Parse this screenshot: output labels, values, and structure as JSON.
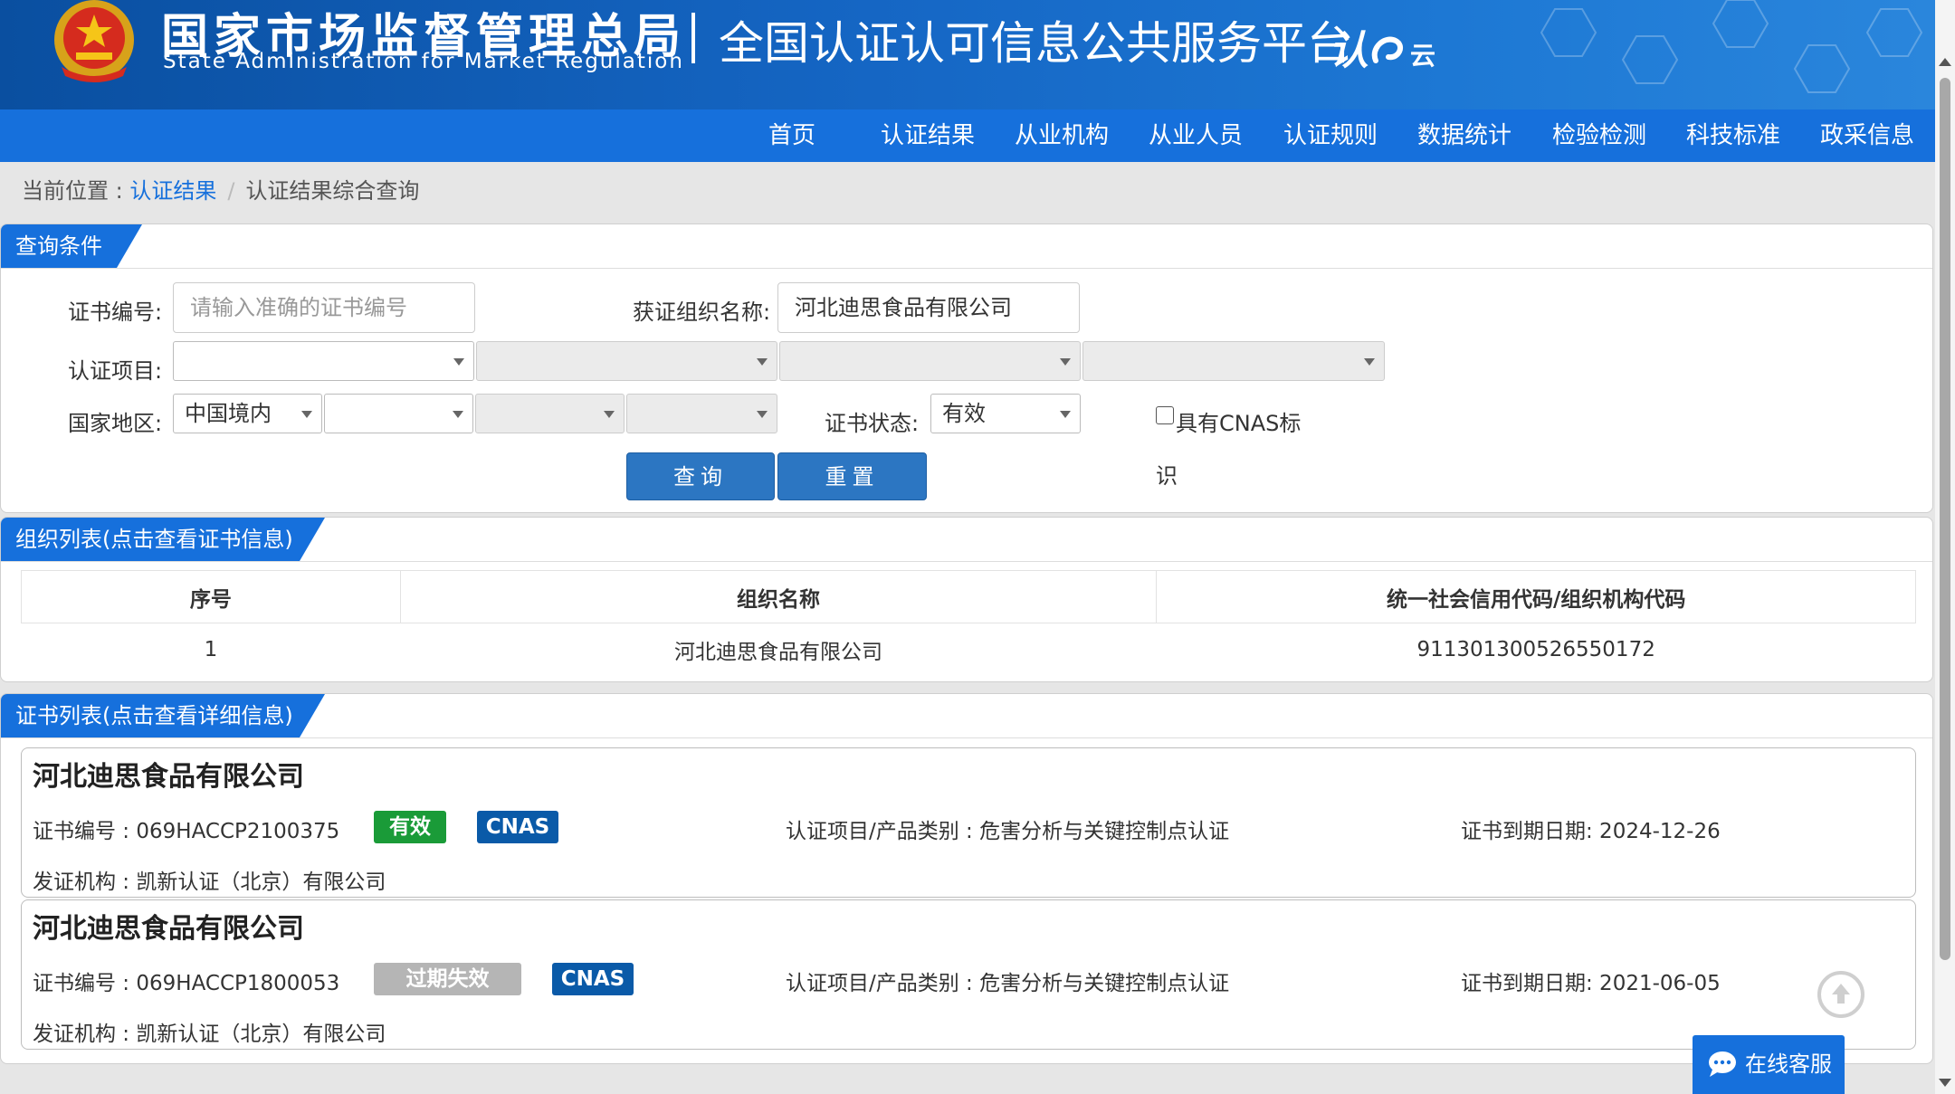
{
  "header": {
    "agency_cn": "国家市场监督管理总局",
    "agency_en": "State Administration  for  Market Regulation",
    "platform_title": "全国认证认可信息公共服务平台",
    "platform_logo": "认",
    "platform_logo_suffix": "云"
  },
  "nav": {
    "items": [
      "首页",
      "认证结果",
      "从业机构",
      "从业人员",
      "认证规则",
      "数据统计",
      "检验检测",
      "科技标准",
      "政采信息"
    ]
  },
  "breadcrumb": {
    "prefix": "当前位置 : ",
    "link": "认证结果",
    "separator": "/",
    "current": "认证结果综合查询"
  },
  "query_panel": {
    "title": "查询条件",
    "cert_no_label": "证书编号:",
    "cert_no_placeholder": "请输入准确的证书编号",
    "cert_no_value": "",
    "org_name_label": "获证组织名称:",
    "org_name_value": "河北迪思食品有限公司",
    "cert_item_label": "认证项目:",
    "cert_item_selects": [
      "",
      "",
      "",
      ""
    ],
    "region_label": "国家地区:",
    "region_selects": [
      "中国境内",
      "",
      "",
      ""
    ],
    "status_label": "证书状态:",
    "status_value": "有效",
    "cnas_label_line1": "具有CNAS标",
    "cnas_label_line2": "识",
    "query_button": "查询",
    "reset_button": "重置"
  },
  "org_panel": {
    "title": "组织列表(点击查看证书信息)",
    "columns": [
      "序号",
      "组织名称",
      "统一社会信用代码/组织机构代码"
    ],
    "rows": [
      [
        "1",
        "河北迪思食品有限公司",
        "911301300526550172"
      ]
    ]
  },
  "cert_panel": {
    "title": "证书列表(点击查看详细信息)",
    "cards": [
      {
        "org": "河北迪思食品有限公司",
        "cert_no": "证书编号 : 069HACCP2100375",
        "status": "有效",
        "status_color": "#1a9b38",
        "cnas": "CNAS",
        "category": "认证项目/产品类别 : 危害分析与关键控制点认证",
        "expiry": "证书到期日期: 2024-12-26",
        "issuer": "发证机构 : 凯新认证（北京）有限公司"
      },
      {
        "org": "河北迪思食品有限公司",
        "cert_no": "证书编号 : 069HACCP1800053",
        "status": "过期失效",
        "status_color": "#b5b5b5",
        "cnas": "CNAS",
        "category": "认证项目/产品类别 : 危害分析与关键控制点认证",
        "expiry": "证书到期日期: 2021-06-05",
        "issuer": "发证机构 : 凯新认证（北京）有限公司"
      }
    ]
  },
  "chat_widget": {
    "label": "在线客服"
  },
  "colors": {
    "primary": "#1670dc",
    "cnas_badge": "#0a5aa8",
    "valid_badge": "#1a9b38",
    "expired_badge": "#b5b5b5"
  }
}
